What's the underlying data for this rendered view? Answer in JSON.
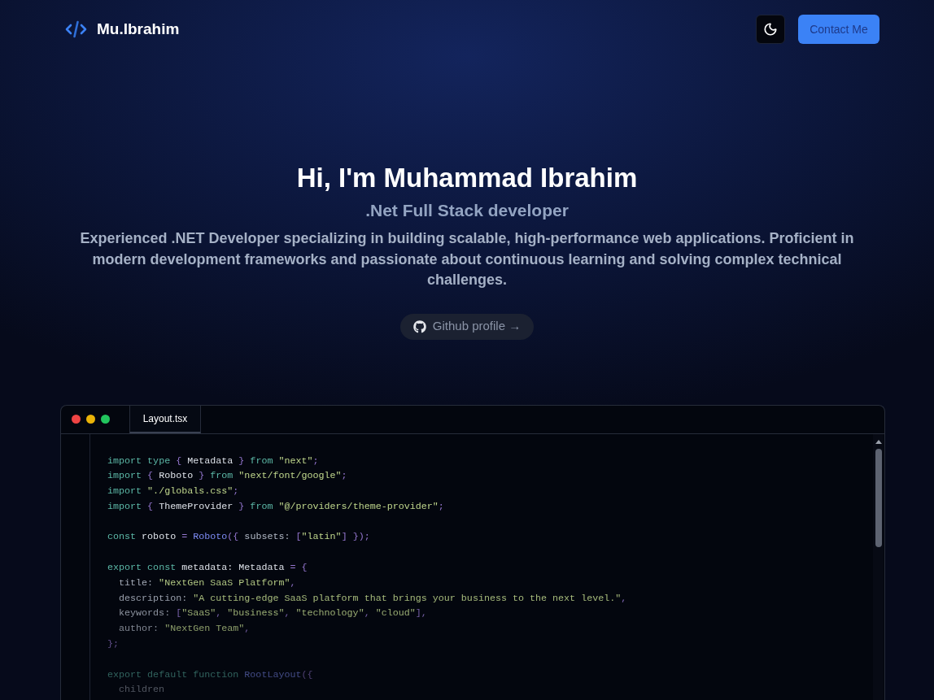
{
  "header": {
    "logo": "Mu.Ibrahim",
    "contact_button": "Contact Me"
  },
  "hero": {
    "title": "Hi, I'm Muhammad Ibrahim",
    "subtitle": ".Net Full Stack developer",
    "description": "Experienced .NET Developer specializing in building scalable, high-performance web applications. Proficient in modern development frameworks and passionate about continuous learning and solving complex technical challenges.",
    "github_button": "Github profile →"
  },
  "editor": {
    "tabs": [
      {
        "label": "Layout.tsx",
        "selected": true
      }
    ],
    "code_blocks": [
      {
        "lines": [
          {
            "tokens": [
              {
                "text": "import",
                "kind": "keyword"
              },
              {
                "text": " type",
                "kind": "keyword"
              },
              {
                "text": " {",
                "kind": "punctuation"
              },
              {
                "text": " Metadata",
                "kind": "identifier"
              },
              {
                "text": " }",
                "kind": "punctuation"
              },
              {
                "text": " from",
                "kind": "keyword"
              },
              {
                "text": " \"next\"",
                "kind": "string"
              },
              {
                "text": ";",
                "kind": "punctuation"
              }
            ]
          },
          {
            "tokens": [
              {
                "text": "import",
                "kind": "keyword"
              },
              {
                "text": " {",
                "kind": "punctuation"
              },
              {
                "text": " Roboto",
                "kind": "identifier"
              },
              {
                "text": " }",
                "kind": "punctuation"
              },
              {
                "text": " from",
                "kind": "keyword"
              },
              {
                "text": " \"next/font/google\"",
                "kind": "string"
              },
              {
                "text": ";",
                "kind": "punctuation"
              }
            ]
          },
          {
            "tokens": [
              {
                "text": "import",
                "kind": "keyword"
              },
              {
                "text": " \"./globals.css\"",
                "kind": "string"
              },
              {
                "text": ";",
                "kind": "punctuation"
              }
            ]
          },
          {
            "tokens": [
              {
                "text": "import",
                "kind": "keyword"
              },
              {
                "text": " {",
                "kind": "punctuation"
              },
              {
                "text": " ThemeProvider",
                "kind": "identifier"
              },
              {
                "text": " }",
                "kind": "punctuation"
              },
              {
                "text": " from",
                "kind": "keyword"
              },
              {
                "text": " \"@/providers/theme-provider\"",
                "kind": "string"
              },
              {
                "text": ";",
                "kind": "punctuation"
              }
            ]
          }
        ]
      },
      {
        "lines": [
          {
            "tokens": [
              {
                "text": "const",
                "kind": "keyword"
              },
              {
                "text": " roboto",
                "kind": "identifier"
              },
              {
                "text": " =",
                "kind": "punctuation"
              },
              {
                "text": " Roboto",
                "kind": "function"
              },
              {
                "text": "({",
                "kind": "punctuation"
              },
              {
                "text": " subsets:",
                "kind": "property"
              },
              {
                "text": " [",
                "kind": "punctuation"
              },
              {
                "text": "\"latin\"",
                "kind": "string"
              },
              {
                "text": "] });",
                "kind": "punctuation"
              }
            ]
          }
        ]
      },
      {
        "lines": [
          {
            "tokens": [
              {
                "text": "export",
                "kind": "keyword"
              },
              {
                "text": " const",
                "kind": "keyword"
              },
              {
                "text": " metadata:",
                "kind": "identifier"
              },
              {
                "text": " Metadata",
                "kind": "identifier"
              },
              {
                "text": " = {",
                "kind": "punctuation"
              }
            ]
          },
          {
            "tokens": [
              {
                "text": "  title:",
                "kind": "property"
              },
              {
                "text": " \"NextGen SaaS Platform\"",
                "kind": "string"
              },
              {
                "text": ",",
                "kind": "punctuation"
              }
            ]
          },
          {
            "tokens": [
              {
                "text": "  description:",
                "kind": "property"
              },
              {
                "text": " \"A cutting-edge SaaS platform that brings your business to the next level.\"",
                "kind": "string"
              },
              {
                "text": ",",
                "kind": "punctuation"
              }
            ]
          },
          {
            "tokens": [
              {
                "text": "  keywords:",
                "kind": "property"
              },
              {
                "text": " [",
                "kind": "punctuation"
              },
              {
                "text": "\"SaaS\"",
                "kind": "string"
              },
              {
                "text": ", ",
                "kind": "punctuation"
              },
              {
                "text": "\"business\"",
                "kind": "string"
              },
              {
                "text": ", ",
                "kind": "punctuation"
              },
              {
                "text": "\"technology\"",
                "kind": "string"
              },
              {
                "text": ", ",
                "kind": "punctuation"
              },
              {
                "text": "\"cloud\"",
                "kind": "string"
              },
              {
                "text": "],",
                "kind": "punctuation"
              }
            ]
          },
          {
            "tokens": [
              {
                "text": "  author:",
                "kind": "property"
              },
              {
                "text": " \"NextGen Team\"",
                "kind": "string"
              },
              {
                "text": ",",
                "kind": "punctuation"
              }
            ]
          },
          {
            "tokens": [
              {
                "text": "};",
                "kind": "punctuation"
              }
            ]
          }
        ]
      },
      {
        "lines": [
          {
            "tokens": [
              {
                "text": "export",
                "kind": "keyword"
              },
              {
                "text": " default",
                "kind": "keyword"
              },
              {
                "text": " function",
                "kind": "keyword"
              },
              {
                "text": " RootLayout",
                "kind": "function"
              },
              {
                "text": "({",
                "kind": "punctuation"
              }
            ]
          },
          {
            "tokens": [
              {
                "text": "  children",
                "kind": "property"
              }
            ]
          }
        ]
      }
    ]
  }
}
